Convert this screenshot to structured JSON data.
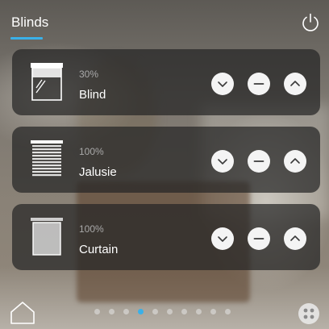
{
  "header": {
    "title": "Blinds"
  },
  "blinds": [
    {
      "type": "blind",
      "percent": "30%",
      "name": "Blind"
    },
    {
      "type": "jalusie",
      "percent": "100%",
      "name": "Jalusie"
    },
    {
      "type": "curtain",
      "percent": "100%",
      "name": "Curtain"
    }
  ],
  "pagination": {
    "count": 10,
    "active_index": 3
  },
  "icons": {
    "power": "power-icon",
    "home": "home-icon",
    "menu": "app-grid-icon",
    "down": "chevron-down-icon",
    "stop": "stop-minus-icon",
    "up": "chevron-up-icon"
  },
  "colors": {
    "accent": "#3ab0e8",
    "card_bg": "rgba(38,38,38,0.72)",
    "button_bg": "#f4f4f4"
  }
}
